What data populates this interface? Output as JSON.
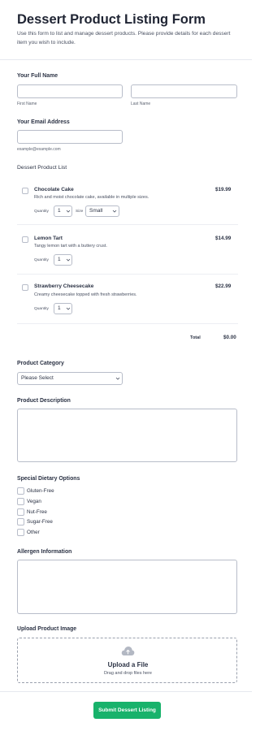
{
  "form": {
    "title": "Dessert Product Listing Form",
    "subtitle": "Use this form to list and manage dessert products. Please provide details for each dessert item you wish to include."
  },
  "name": {
    "label": "Your Full Name",
    "first_sublabel": "First Name",
    "last_sublabel": "Last Name",
    "first_value": "",
    "last_value": ""
  },
  "email": {
    "label": "Your Email Address",
    "sublabel": "example@example.com",
    "value": ""
  },
  "products": {
    "label": "Dessert Product List",
    "quantity_label": "Quantity",
    "size_label": "Size",
    "items": [
      {
        "name": "Chocolate Cake",
        "description": "Rich and moist chocolate cake, available in multiple sizes.",
        "price": "$19.99",
        "quantity": "1",
        "size": "Small",
        "checked": false
      },
      {
        "name": "Lemon Tart",
        "description": "Tangy lemon tart with a buttery crust.",
        "price": "$14.99",
        "quantity": "1",
        "checked": false
      },
      {
        "name": "Strawberry Cheesecake",
        "description": "Creamy cheesecake topped with fresh strawberries.",
        "price": "$22.99",
        "quantity": "1",
        "checked": false
      }
    ],
    "total_label": "Total",
    "total_value": "$0.00"
  },
  "category": {
    "label": "Product Category",
    "selected": "Please Select"
  },
  "description": {
    "label": "Product Description",
    "value": ""
  },
  "dietary": {
    "label": "Special Dietary Options",
    "options": [
      "Gluten-Free",
      "Vegan",
      "Nut-Free",
      "Sugar-Free",
      "Other"
    ]
  },
  "allergen": {
    "label": "Allergen Information",
    "value": ""
  },
  "upload": {
    "label": "Upload Product Image",
    "title": "Upload a File",
    "subtitle": "Drag and drop files here",
    "icon": "cloud-upload-icon"
  },
  "submit": {
    "label": "Submit Dessert Listing"
  },
  "colors": {
    "accent": "#18b26b",
    "text": "#2c3345",
    "border": "#b8bdc9"
  }
}
